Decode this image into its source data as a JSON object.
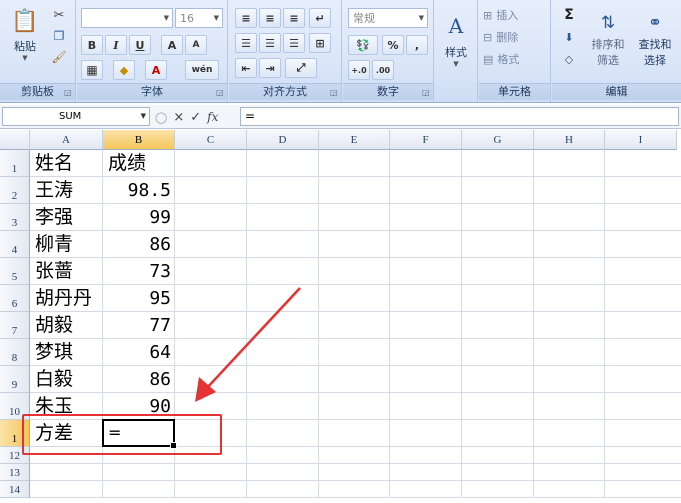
{
  "ribbon": {
    "clipboard": {
      "label": "剪贴板",
      "paste": "粘贴"
    },
    "font": {
      "label": "字体",
      "font_name": "",
      "font_size": "16",
      "bold": "B",
      "italic": "I",
      "underline": "U",
      "grow": "A",
      "shrink": "A",
      "wen": "wén"
    },
    "alignment": {
      "label": "对齐方式"
    },
    "number": {
      "label": "数字",
      "format": "常规",
      "percent": "%",
      "comma": ",",
      "inc": "+.0",
      "dec": ".00"
    },
    "styles": {
      "label": "样式"
    },
    "cells": {
      "label": "单元格",
      "insert": "插入",
      "delete": "删除",
      "format": "格式"
    },
    "editing": {
      "label": "编辑",
      "sort": "排序和",
      "filter": "筛选",
      "find": "查找和",
      "select": "选择"
    }
  },
  "formula_bar": {
    "name_box": "SUM",
    "fx": "fx",
    "cancel": "×",
    "enter": "✓",
    "content": "="
  },
  "columns": [
    "A",
    "B",
    "C",
    "D",
    "E",
    "F",
    "G",
    "H",
    "I"
  ],
  "rows": [
    "1",
    "2",
    "3",
    "4",
    "5",
    "6",
    "7",
    "8",
    "9",
    "10",
    "1",
    "12",
    "13",
    "14"
  ],
  "cells": {
    "header": {
      "name": "姓名",
      "score": "成绩"
    },
    "records": [
      {
        "name": "王涛",
        "score": "98.5"
      },
      {
        "name": "李强",
        "score": "99"
      },
      {
        "name": "柳青",
        "score": "86"
      },
      {
        "name": "张蔷",
        "score": "73"
      },
      {
        "name": "胡丹丹",
        "score": "95"
      },
      {
        "name": "胡毅",
        "score": "77"
      },
      {
        "name": "梦琪",
        "score": "64"
      },
      {
        "name": "白毅",
        "score": "86"
      },
      {
        "name": "朱玉",
        "score": "90"
      }
    ],
    "variance_label": "方差",
    "active_input": "="
  },
  "colors": {
    "annotation": "#e53333",
    "active_header": "#f5c65a"
  }
}
